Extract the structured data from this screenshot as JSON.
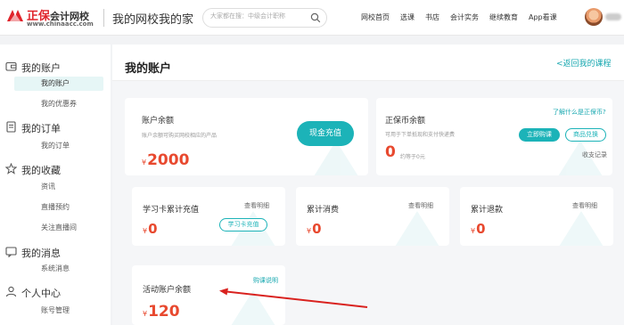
{
  "header": {
    "logo_brand": "正保",
    "logo_name": "会计网校",
    "logo_url": "www.chinaacc.com",
    "site_title": "我的网校我的家",
    "search_placeholder": "大家都在搜：中级会计职称",
    "nav": [
      "网校首页",
      "选课",
      "书店",
      "会计实务",
      "继续教育",
      "App看课"
    ]
  },
  "sidebar": {
    "groups": [
      {
        "title": "我的账户",
        "icon": "wallet-icon",
        "items": [
          "我的账户",
          "我的优惠券"
        ]
      },
      {
        "title": "我的订单",
        "icon": "order-icon",
        "items": [
          "我的订单"
        ]
      },
      {
        "title": "我的收藏",
        "icon": "star-icon",
        "items": [
          "资讯",
          "直播预约",
          "关注直播间"
        ]
      },
      {
        "title": "我的消息",
        "icon": "message-icon",
        "items": [
          "系统消息"
        ]
      },
      {
        "title": "个人中心",
        "icon": "user-icon",
        "items": [
          "账号管理"
        ]
      }
    ]
  },
  "main": {
    "title": "我的账户",
    "back_link": "<返回我的课程",
    "balance": {
      "label": "账户余额",
      "desc": "账户余额可购买网校相应的产品",
      "currency": "¥",
      "amount": "2000",
      "button": "现金充值"
    },
    "coin": {
      "label": "正保币余额",
      "desc": "可用于下单抵现和支付快递费",
      "help": "了解什么是正保币?",
      "amount": "0",
      "equiv": "约等于0元",
      "buy_button": "立即购课",
      "exchange_button": "商品兑换",
      "records": "收支记录"
    },
    "study_card": {
      "label": "学习卡累计充值",
      "detail": "查看明细",
      "currency": "¥",
      "amount": "0",
      "button": "学习卡充值"
    },
    "consume": {
      "label": "累计消费",
      "detail": "查看明细",
      "currency": "¥",
      "amount": "0"
    },
    "refund": {
      "label": "累计退款",
      "detail": "查看明细",
      "currency": "¥",
      "amount": "0"
    },
    "activity": {
      "label": "活动账户余额",
      "detail": "购课说明",
      "currency": "¥",
      "amount": "120"
    }
  },
  "colors": {
    "accent": "#1cb3b8",
    "amount": "#e8492f",
    "brand": "#e0242b"
  }
}
